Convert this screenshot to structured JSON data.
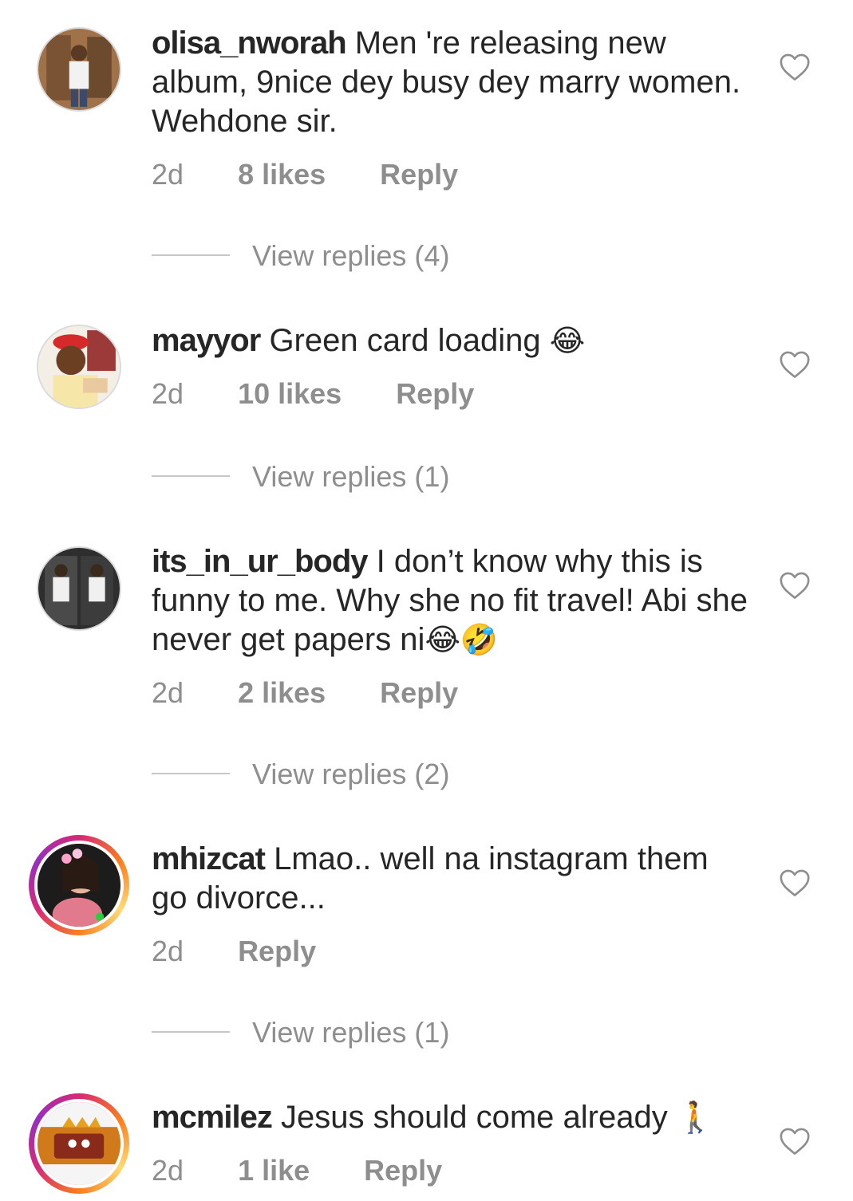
{
  "comments": [
    {
      "username": "olisa_nworah",
      "text": "Men 're releasing new album, 9nice dey busy dey marry women. Wehdone sir.",
      "time": "2d",
      "likes": "8 likes",
      "reply": "Reply",
      "view_replies": "View replies (4)",
      "icon": "heart-outline-icon"
    },
    {
      "username": "mayyor",
      "text": "Green card loading",
      "emoji": "😂",
      "time": "2d",
      "likes": "10 likes",
      "reply": "Reply",
      "view_replies": "View replies (1)",
      "icon": "heart-outline-icon"
    },
    {
      "username": "its_in_ur_body",
      "text": "I don’t know why this is funny to me. Why she no fit travel! Abi she never get papers ni",
      "emoji": "😂🤣",
      "time": "2d",
      "likes": "2 likes",
      "reply": "Reply",
      "view_replies": "View replies (2)",
      "icon": "heart-outline-icon"
    },
    {
      "username": "mhizcat",
      "text": "Lmao.. well na instagram them go divorce...",
      "time": "2d",
      "reply": "Reply",
      "view_replies": "View replies (1)",
      "icon": "heart-outline-icon"
    },
    {
      "username": "mcmilez",
      "text": "Jesus should come already",
      "emoji": "🚶",
      "time": "2d",
      "likes": "1 like",
      "reply": "Reply",
      "icon": "heart-outline-icon"
    }
  ],
  "colors": {
    "text": "#262626",
    "secondary": "#8e8e8e",
    "divider": "#c7c7c7"
  }
}
